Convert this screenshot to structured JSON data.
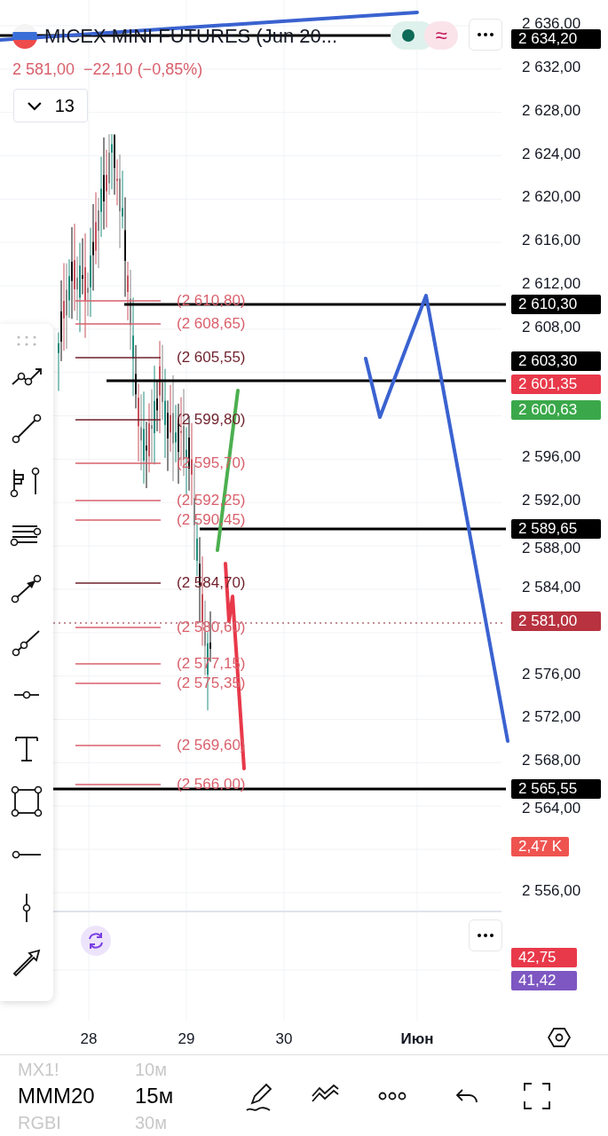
{
  "header": {
    "title": "MICEX MINI FUTURES (Jun 20...",
    "market_open": true,
    "delay_mark": "≈",
    "price": "2 581,00",
    "change": "−22,10 (−0,85%)",
    "indicators": {
      "count": "13",
      "expanded": false
    }
  },
  "price_axis": {
    "ticks": [
      "2 636,00",
      "2 632,00",
      "2 628,00",
      "2 624,00",
      "2 620,00",
      "2 616,00",
      "2 612,00",
      "2 608,00",
      "2 596,00",
      "2 592,00",
      "2 588,00",
      "2 584,00",
      "2 576,00",
      "2 572,00",
      "2 568,00",
      "2 564,00",
      "2 556,00"
    ]
  },
  "price_tags": [
    {
      "text": "2 634,20",
      "color": "#000000"
    },
    {
      "text": "2 610,30",
      "color": "#000000"
    },
    {
      "text": "2 603,30",
      "color": "#000000"
    },
    {
      "text": "2 601,35",
      "color": "#e8394a"
    },
    {
      "text": "2 600,63",
      "color": "#3aa84a"
    },
    {
      "text": "2 589,65",
      "color": "#000000"
    },
    {
      "text": "2 581,00",
      "color": "#b8323f"
    },
    {
      "text": "2 565,55",
      "color": "#000000"
    },
    {
      "text": "2,47 K",
      "color": "#ef5350"
    }
  ],
  "fib_levels": [
    {
      "text": "(2 610,80)",
      "color": "#d9606c"
    },
    {
      "text": "(2 608,65)",
      "color": "#d9606c"
    },
    {
      "text": "(2 605,55)",
      "color": "#6e1f2a"
    },
    {
      "text": "(2 599,80)",
      "color": "#6e1f2a"
    },
    {
      "text": "(2 595,70)",
      "color": "#d9606c"
    },
    {
      "text": "(2 592,25)",
      "color": "#d9606c"
    },
    {
      "text": "(2 590,45)",
      "color": "#d9606c"
    },
    {
      "text": "(2 584,70)",
      "color": "#6e1f2a"
    },
    {
      "text": "(2 580,60)",
      "color": "#d9606c"
    },
    {
      "text": "(2 577,15)",
      "color": "#d9606c"
    },
    {
      "text": "(2 575,35)",
      "color": "#d9606c"
    },
    {
      "text": "(2 569,60)",
      "color": "#d9606c"
    },
    {
      "text": "(2 566,00)",
      "color": "#d9606c"
    }
  ],
  "oscillator_tags": [
    {
      "text": "42,75",
      "color": "#e8394a"
    },
    {
      "text": "41,42",
      "color": "#7e57c2"
    }
  ],
  "time_axis": [
    {
      "label": "28",
      "kind": "day"
    },
    {
      "label": "29",
      "kind": "day"
    },
    {
      "label": "30",
      "kind": "day"
    },
    {
      "label": "Июн",
      "kind": "month"
    }
  ],
  "symbols": [
    {
      "label": "MX1!",
      "selected": false
    },
    {
      "label": "MMM20",
      "selected": true
    },
    {
      "label": "RGBI",
      "selected": false
    }
  ],
  "timeframes": [
    {
      "label": "10м",
      "selected": false
    },
    {
      "label": "15м",
      "selected": true
    },
    {
      "label": "30м",
      "selected": false
    }
  ]
}
